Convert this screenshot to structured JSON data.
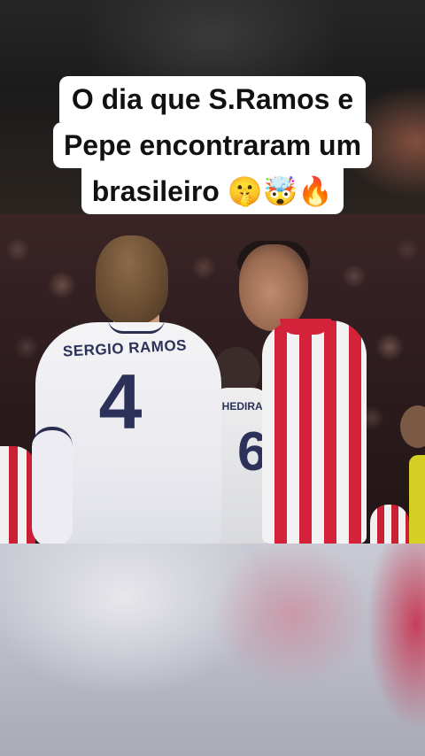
{
  "caption": {
    "line1": "O dia que S.Ramos e",
    "line2": "Pepe encontraram um",
    "line3_text": "brasileiro",
    "line3_emojis": "🤫🤯🔥"
  },
  "video": {
    "player_left_name": "SERGIO RAMOS",
    "player_left_number": "4",
    "player_middle_name": "KHEDIRA",
    "player_middle_number": "6"
  },
  "colors": {
    "caption_bg": "#ffffff",
    "caption_text": "#111111",
    "kit_white_text": "#2b3158",
    "kit_red": "#d3223a"
  }
}
